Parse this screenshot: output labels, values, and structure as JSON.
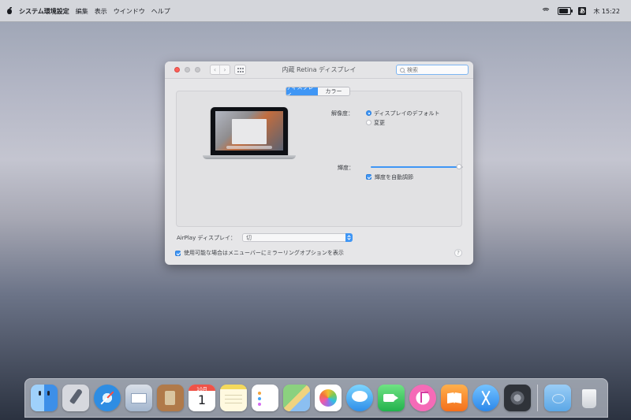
{
  "menubar": {
    "app_name": "システム環境設定",
    "menus": [
      "編集",
      "表示",
      "ウインドウ",
      "ヘルプ"
    ],
    "clock": "木 15:22"
  },
  "window": {
    "title": "内蔵 Retina ディスプレイ",
    "search_placeholder": "検索",
    "tabs": [
      "ディスプレイ",
      "カラー"
    ],
    "active_tab": "ディスプレイ"
  },
  "display": {
    "resolution_label": "解像度：",
    "resolution_options": [
      "ディスプレイのデフォルト",
      "変更"
    ],
    "selected_resolution": "ディスプレイのデフォルト",
    "brightness_label": "輝度：",
    "brightness_level": 0.96,
    "auto_brightness_label": "輝度を自動調節",
    "auto_brightness_enabled": true
  },
  "airplay": {
    "label": "AirPlay ディスプレイ：",
    "selected": "切"
  },
  "mirroring": {
    "label": "使用可能な場合はメニューバーにミラーリングオプションを表示",
    "enabled": true
  },
  "help": {
    "label": "?"
  },
  "dock": {
    "calendar_month": "10月",
    "calendar_day": "1",
    "apps": [
      "finder-icon",
      "launchpad-icon",
      "safari-icon",
      "mail-icon",
      "contacts-icon",
      "calendar-icon",
      "notes-icon",
      "reminders-icon",
      "maps-icon",
      "photos-icon",
      "messages-icon",
      "facetime-icon",
      "itunes-icon",
      "ibooks-icon",
      "app-store-icon",
      "system-preferences-icon"
    ],
    "extras": [
      "downloads-folder-icon",
      "trash-icon"
    ]
  },
  "colors": {
    "accent": "#3f96f5",
    "close": "#ff5f57"
  }
}
